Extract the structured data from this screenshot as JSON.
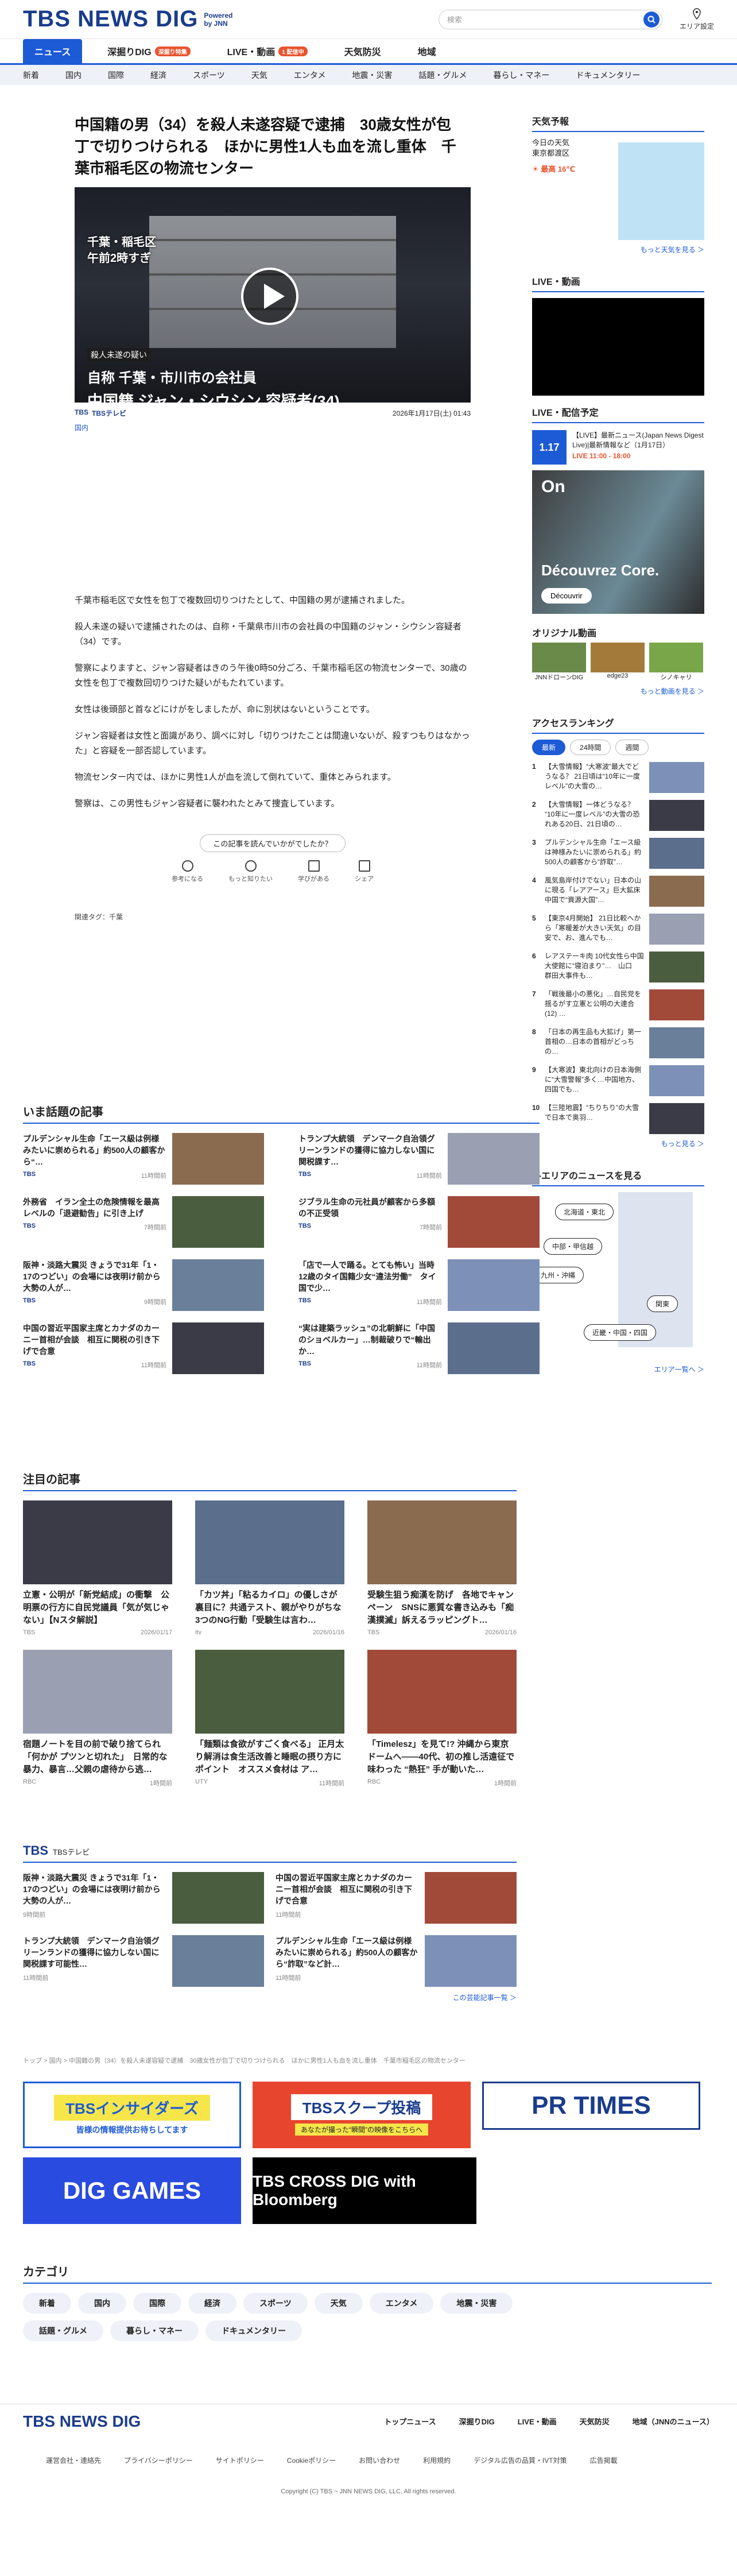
{
  "header": {
    "logo": "TBS NEWS DIG",
    "powered": "Powered\nby JNN",
    "search_placeholder": "検索",
    "area": "エリア設定"
  },
  "mainnav": [
    {
      "label": "ニュース",
      "active": true
    },
    {
      "label": "深掘りDIG",
      "badge": "深掘り特集"
    },
    {
      "label": "LIVE・動画",
      "badge": "1 配信中"
    },
    {
      "label": "天気防災"
    },
    {
      "label": "地域"
    }
  ],
  "subnav": [
    "新着",
    "国内",
    "国際",
    "経済",
    "スポーツ",
    "天気",
    "エンタメ",
    "地震・災害",
    "話題・グルメ",
    "暮らし・マネー",
    "ドキュメンタリー"
  ],
  "article": {
    "title": "中国籍の男（34）を殺人未遂容疑で逮捕　30歳女性が包丁で切りつけられる　ほかに男性1人も血を流し重体　千葉市稲毛区の物流センター",
    "hero_loc": "千葉・稲毛区\n午前2時すぎ",
    "hero_sub": "殺人未遂の疑い",
    "hero_l1": "自称 千葉・市川市の会社員",
    "hero_l2": "中国籍 ジャン・シウシン 容疑者(34)",
    "source": "TBSテレビ",
    "date": "2026年1月17日(土) 01:43",
    "category": "国内",
    "paragraphs": [
      "千葉市稲毛区で女性を包丁で複数回切りつけたとして、中国籍の男が逮捕されました。",
      "殺人未遂の疑いで逮捕されたのは、自称・千葉県市川市の会社員の中国籍のジャン・シウシン容疑者（34）です。",
      "警察によりますと、ジャン容疑者はきのう午後0時50分ごろ、千葉市稲毛区の物流センターで、30歳の女性を包丁で複数回切りつけた疑いがもたれています。",
      "女性は後頭部と首などにけがをしましたが、命に別状はないということです。",
      "ジャン容疑者は女性と面識があり、調べに対し「切りつけたことは間違いないが、殺すつもりはなかった」と容疑を一部否認しています。",
      "物流センター内では、ほかに男性1人が血を流して倒れていて、重体とみられます。",
      "警察は、この男性もジャン容疑者に襲われたとみて捜査しています。"
    ],
    "question": "この記事を読んでいかがでしたか？",
    "reactions": [
      "参考になる",
      "もっと知りたい",
      "学びがある",
      "シェア"
    ],
    "tags": "関連タグ：千葉"
  },
  "trending": {
    "title": "いま話題の記事",
    "items": [
      {
        "t": "プルデンシャル生命「エース級は例様みたいに崇められる」約500人の顧客から“…",
        "b": "TBS",
        "d": "11時間前"
      },
      {
        "t": "トランプ大統領　デンマーク自治領グリーンランドの獲得に協力しない国に関税課す…",
        "b": "TBS",
        "d": "11時間前"
      },
      {
        "t": "外務省　イラン全土の危険情報を最高レベルの「退避勧告」に引き上げ",
        "b": "TBS",
        "d": "7時間前"
      },
      {
        "t": "ジブラル生命の元社員が顧客から多額の不正受領",
        "b": "TBS",
        "d": "7時間前"
      },
      {
        "t": "阪神・淡路大震災 きょうで31年「1・17のつどい」の会場には夜明け前から大勢の人が…",
        "b": "TBS",
        "d": "9時間前"
      },
      {
        "t": "「店で一人で踊る。とても怖い」当時12歳のタイ国籍少女“違法労働”　タイ国で少…",
        "b": "TBS",
        "d": "11時間前"
      },
      {
        "t": "中国の習近平国家主席とカナダのカーニー首相が会談　相互に関税の引き下げで合意",
        "b": "TBS",
        "d": "11時間前"
      },
      {
        "t": "“実は建築ラッシュ”の北朝鮮に「中国のショベルカー」…制裁破りで“輸出か…",
        "b": "TBS",
        "d": "11時間前"
      }
    ]
  },
  "featured": {
    "title": "注目の記事",
    "items": [
      {
        "t": "立憲・公明が「新党結成」の衝撃　公明票の行方に自民党議員「気が気じゃない」【Nスタ解説】",
        "b": "TBS",
        "d": "2026/01/17"
      },
      {
        "t": "「カツ丼」「粘るカイロ」の優しさが裏目に？共通テスト、親がやりがちな3つのNG行動「受験生は言わ…",
        "b": "itv",
        "d": "2026/01/16"
      },
      {
        "t": "受験生狙う痴漢を防げ　各地でキャンペーン　SNSに悪質な書き込みも「痴漢撲滅」訴えるラッピングト…",
        "b": "TBS",
        "d": "2026/01/16"
      },
      {
        "t": "宿題ノートを目の前で破り捨てられ「何かが プツンと切れた」　日常的な暴力、暴言…父親の虐待から逃…",
        "b": "RBC",
        "d": "1時間前"
      },
      {
        "t": "「麺類は食欲がすごく食べる」 正月太り解消は食生活改善と睡眠の摂り方にポイント　オススメ食材は ア…",
        "b": "UTY",
        "d": "11時間前"
      },
      {
        "t": "「Timelesz」を見て!? 沖縄から東京ドームへ——40代、初の推し活遠征で味わった “熱狂” 手が動いた…",
        "b": "RBC",
        "d": "1時間前"
      }
    ]
  },
  "tbs": {
    "title": "TBSテレビ",
    "items": [
      {
        "t": "阪神・淡路大震災 きょうで31年「1・17のつどい」の会場には夜明け前から大勢の人が…",
        "d": "9時間前"
      },
      {
        "t": "中国の習近平国家主席とカナダのカーニー首相が会談　相互に関税の引き下げで合意",
        "d": "11時間前"
      },
      {
        "t": "トランプ大統領　デンマーク自治領グリーンランドの獲得に協力しない国に関税課す可能性…",
        "d": "11時間前"
      },
      {
        "t": "プルデンシャル生命「エース級は例様みたいに崇められる」約500人の顧客から“詐取”など計…",
        "d": "11時間前"
      }
    ],
    "more": "この芸能記事一覧 ＞"
  },
  "breadcrumb": "トップ > 国内 > 中国籍の男（34）を殺人未遂容疑で逮捕　30歳女性が包丁で切りつけられる　ほかに男性1人も血を流し重体　千葉市稲毛区の物流センター",
  "banners": [
    "TBSインサイダーズ",
    "TBSスクープ投稿",
    "PR TIMES",
    "DIG GAMES",
    "TBS CROSS DIG with Bloomberg"
  ],
  "banner_subs": [
    "皆様の情報提供お待ちしてます",
    "あなたが撮った“瞬間”の映像をこちらへ"
  ],
  "categories": {
    "title": "カテゴリ",
    "items": [
      "新着",
      "国内",
      "国際",
      "経済",
      "スポーツ",
      "天気",
      "エンタメ",
      "地震・災害",
      "話題・グルメ",
      "暮らし・マネー",
      "ドキュメンタリー"
    ]
  },
  "footer": {
    "logo": "TBS NEWS DIG",
    "nav": [
      "トップニュース",
      "深掘りDIG",
      "LIVE・動画",
      "天気防災",
      "地域（JNNのニュース）"
    ],
    "links": [
      "運営会社・連絡先",
      "プライバシーポリシー",
      "サイトポリシー",
      "Cookieポリシー",
      "お問い合わせ",
      "利用規約",
      "デジタル広告の品質・IVT対策",
      "広告掲載"
    ],
    "copyright": "Copyright (C) TBS ~ JNN NEWS DIG, LLC. All rights reserved."
  },
  "side": {
    "weather_title": "天気予報",
    "weather_place": "今日の天気\n東京都渡区",
    "weather_temp": "最高 16℃",
    "weather_more": "もっと天気を見る ＞",
    "live_title": "LIVE・動画",
    "sched_title": "LIVE・配信予定",
    "sched_time": "1.17",
    "sched_text": "【LIVE】最新ニュース(Japan News Digest Live)|最新情報など（1月17日）",
    "sched_label": "LIVE 11:00 - 18:00",
    "ad_brand": "On",
    "ad_text": "Découvrez Core.",
    "ad_btn": "Découvrir",
    "orig_title": "オリジナル動画",
    "orig": [
      "JNNドローンDIG",
      "edge23",
      "シノキャリ"
    ],
    "orig_more": "もっと動画を見る ＞",
    "rank_title": "アクセスランキング",
    "rank_tabs": [
      "最新",
      "24時間",
      "週間"
    ],
    "rank": [
      "【大雪情報】“大寒波”最大でどうなる？ 21日頃は“10年に一度レベル”の大雪の…",
      "【大雪情報】一体どうなる？ “10年に一度レベル”の大雪の恐れある20日、21日頃の…",
      "プルデンシャル生命「エース級は神様みたいに崇められる」約500人の顧客から“詐取”…",
      "風気島岸付けでない」日本の山に現る「レアアース」巨大鉱床 中国で“資源大国”…",
      "【東京4月開始】 21日比較へから「寒暖差が大きい天気」の目安で、お、進んでも…",
      "レアステーキ肉 10代女性ら中国大使館に“寝泊まり”…　山口　群田大事件も…",
      "「戦後最小の悪化」…自民党を揺るがす立憲と公明の大連合(12) …",
      "「日本の再生品も大拡げ」第一首相の…日本の首相がどっちの…",
      "【大寒波】東北向けの日本海側に“大雪警報”多く…中国地方、四国でも…",
      "【三陸地震】“ちりちり”の大雪で日本で奥羽…"
    ],
    "rank_more": "もっと見る ＞",
    "area_title": "各エリアのニュースを見る",
    "areas": [
      "北海道・東北",
      "中部・甲信越",
      "九州・沖縄",
      "関東",
      "近畿・中国・四国"
    ],
    "area_more": "エリア一覧へ ＞"
  },
  "colors": {
    "brand": "#1a3c8c",
    "accent": "#1d5bd6",
    "live": "#e8552f"
  }
}
